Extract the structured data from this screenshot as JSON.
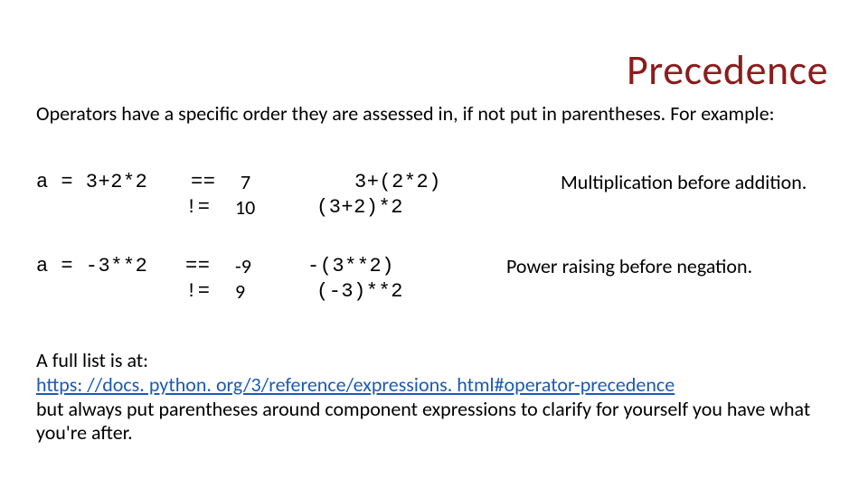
{
  "title": "Precedence",
  "intro": "Operators have a specific order they are assessed in, if not put in parentheses. For example:",
  "ex1": {
    "expr": "a = 3+2*2",
    "op1": "==",
    "op2": "!=",
    "val1": "7",
    "val2": "10",
    "form1": "3+(2*2)",
    "form2": "(3+2)*2",
    "note": "Multiplication before addition."
  },
  "ex2": {
    "expr": "a = -3**2",
    "op1": "==",
    "op2": "!=",
    "val1": "-9",
    "val2": "9",
    "form1": "-(3**2)",
    "form2": "(-3)**2",
    "note": "Power raising before negation."
  },
  "footer": {
    "lead": "A full list is at:",
    "link": "https: //docs. python. org/3/reference/expressions. html#operator-precedence",
    "tail": "but always put parentheses around component expressions to clarify for yourself you have what you're after."
  }
}
